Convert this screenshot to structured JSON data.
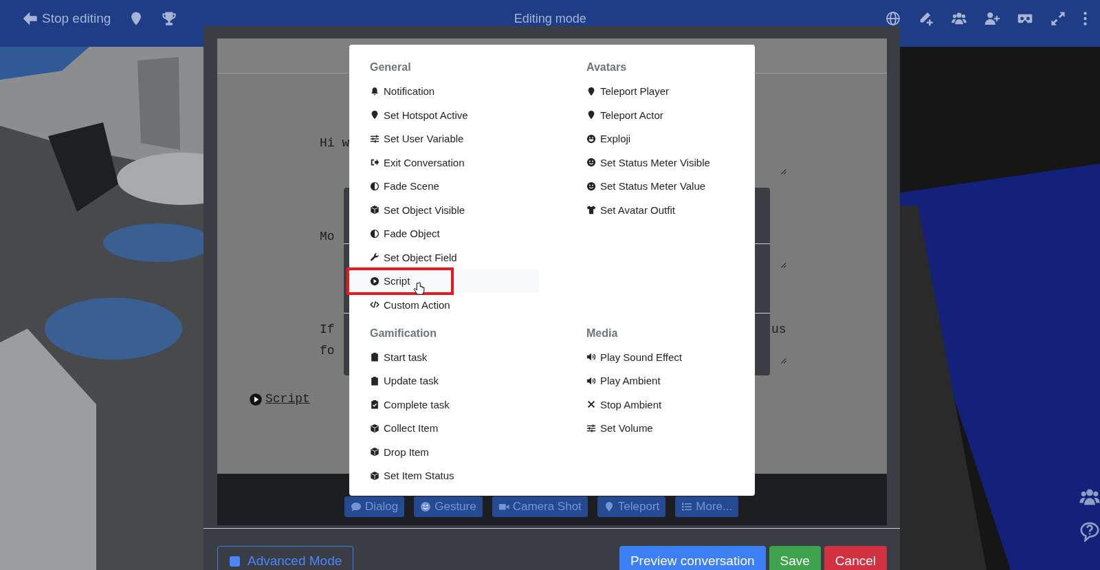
{
  "topbar": {
    "back_button": "Stop editing",
    "title": "Editing mode"
  },
  "dialog": {
    "textareas": [
      {
        "lines": [
          "Hi w"
        ]
      },
      {
        "lines": [
          "Mo"
        ]
      },
      {
        "lines": [
          "If",
          "fo"
        ],
        "line_end": "us"
      }
    ],
    "action_link": "Script",
    "action_buttons": [
      {
        "label": "Dialog"
      },
      {
        "label": "Gesture"
      },
      {
        "label": "Camera Shot"
      },
      {
        "label": "Teleport"
      },
      {
        "label": "More..."
      }
    ],
    "footer": {
      "toggle": "Advanced Mode",
      "buttons": [
        {
          "label": "Preview conversation",
          "kind": "primary"
        },
        {
          "label": "Save",
          "kind": "success"
        },
        {
          "label": "Cancel",
          "kind": "danger"
        }
      ]
    }
  },
  "menu": {
    "sections": [
      {
        "title": "General",
        "items": [
          {
            "label": "Notification",
            "hovered": false
          },
          {
            "label": "Set Hotspot Active",
            "hovered": false
          },
          {
            "label": "Set User Variable",
            "hovered": false
          },
          {
            "label": "Exit Conversation",
            "hovered": false
          },
          {
            "label": "Fade Scene",
            "hovered": false
          },
          {
            "label": "Set Object Visible",
            "hovered": false
          },
          {
            "label": "Fade Object",
            "hovered": false
          },
          {
            "label": "Set Object Field",
            "hovered": false
          },
          {
            "label": "Script",
            "hovered": true
          },
          {
            "label": "Custom Action",
            "hovered": false
          }
        ]
      },
      {
        "title": "Avatars",
        "items": [
          {
            "label": "Teleport Player",
            "hovered": false
          },
          {
            "label": "Teleport Actor",
            "hovered": false
          },
          {
            "label": "Exploji",
            "hovered": false
          },
          {
            "label": "Set Status Meter Visible",
            "hovered": false
          },
          {
            "label": "Set Status Meter Value",
            "hovered": false
          },
          {
            "label": "Set Avatar Outfit",
            "hovered": false
          }
        ]
      },
      {
        "title": "Gamification",
        "items": [
          {
            "label": "Start task",
            "hovered": false
          },
          {
            "label": "Update task",
            "hovered": false
          },
          {
            "label": "Complete task",
            "hovered": false
          },
          {
            "label": "Collect Item",
            "hovered": false
          },
          {
            "label": "Drop Item",
            "hovered": false
          },
          {
            "label": "Set Item Status",
            "hovered": false
          }
        ]
      },
      {
        "title": "Media",
        "items": [
          {
            "label": "Play Sound Effect",
            "hovered": false
          },
          {
            "label": "Play Ambient",
            "hovered": false
          },
          {
            "label": "Stop Ambient",
            "hovered": false
          },
          {
            "label": "Set Volume",
            "hovered": false
          }
        ]
      }
    ]
  }
}
